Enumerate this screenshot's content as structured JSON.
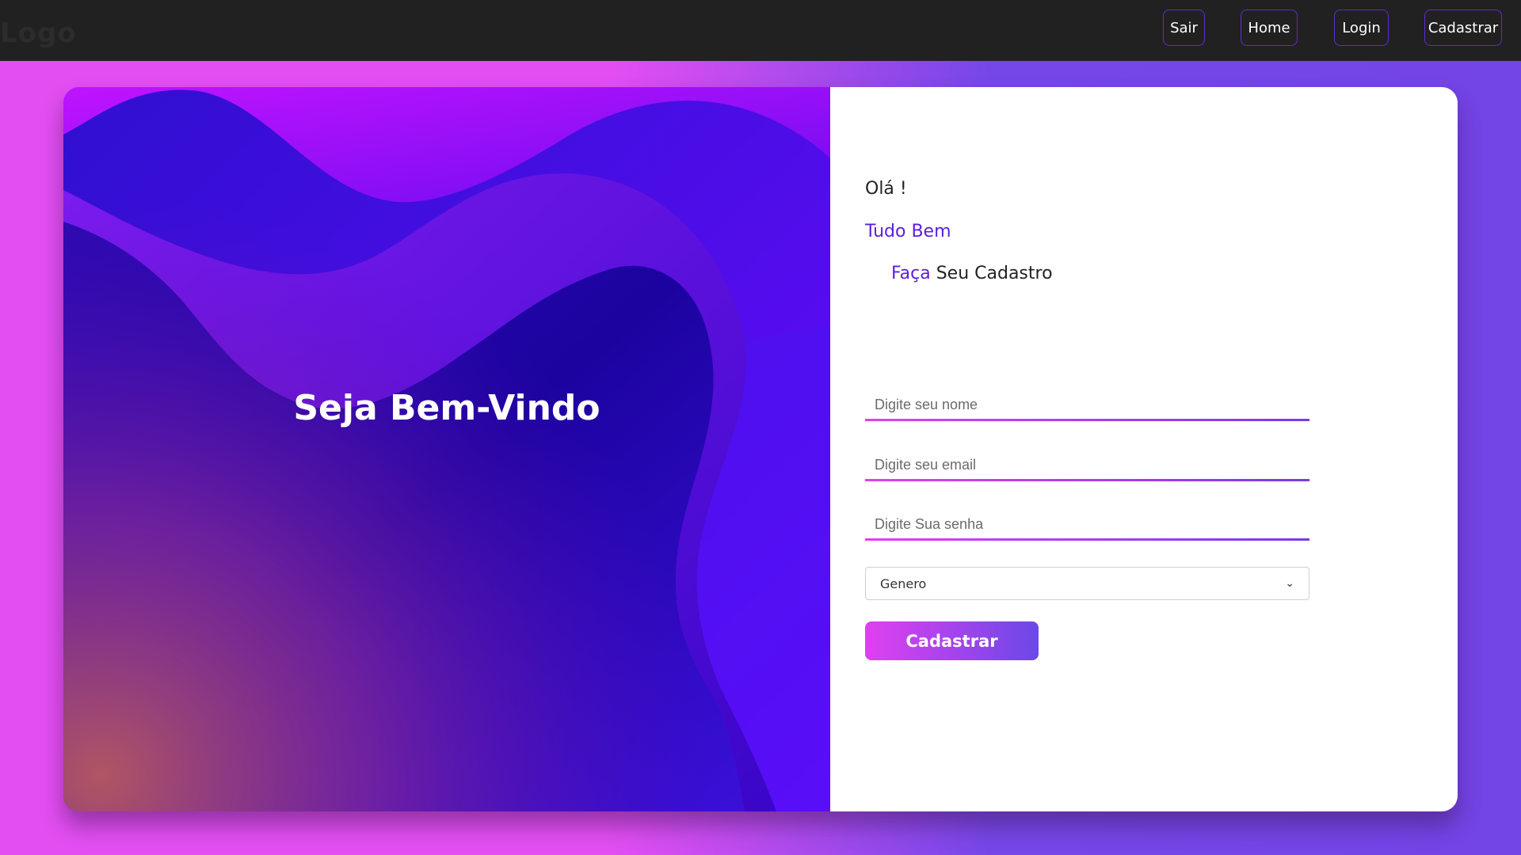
{
  "nav": {
    "logo": "Logo",
    "items": [
      {
        "label": "Sair"
      },
      {
        "label": "Home"
      },
      {
        "label": "Login"
      },
      {
        "label": "Cadastrar"
      }
    ]
  },
  "hero": {
    "welcome": "Seja Bem-Vindo"
  },
  "form": {
    "greeting": "Olá !",
    "subtitle": "Tudo Bem",
    "cta_accent": "Faça",
    "cta_rest": "Seu Cadastro",
    "name_placeholder": "Digite seu nome",
    "email_placeholder": "Digite seu email",
    "password_placeholder": "Digite Sua senha",
    "gender_selected": "Genero",
    "submit_label": "Cadastrar"
  },
  "colors": {
    "accent": "#5b1fe0",
    "gradient_start": "#e040f0",
    "gradient_end": "#6b48e8",
    "navbar": "#212121"
  },
  "icons": {
    "select_arrow": "chevron-down-icon"
  }
}
